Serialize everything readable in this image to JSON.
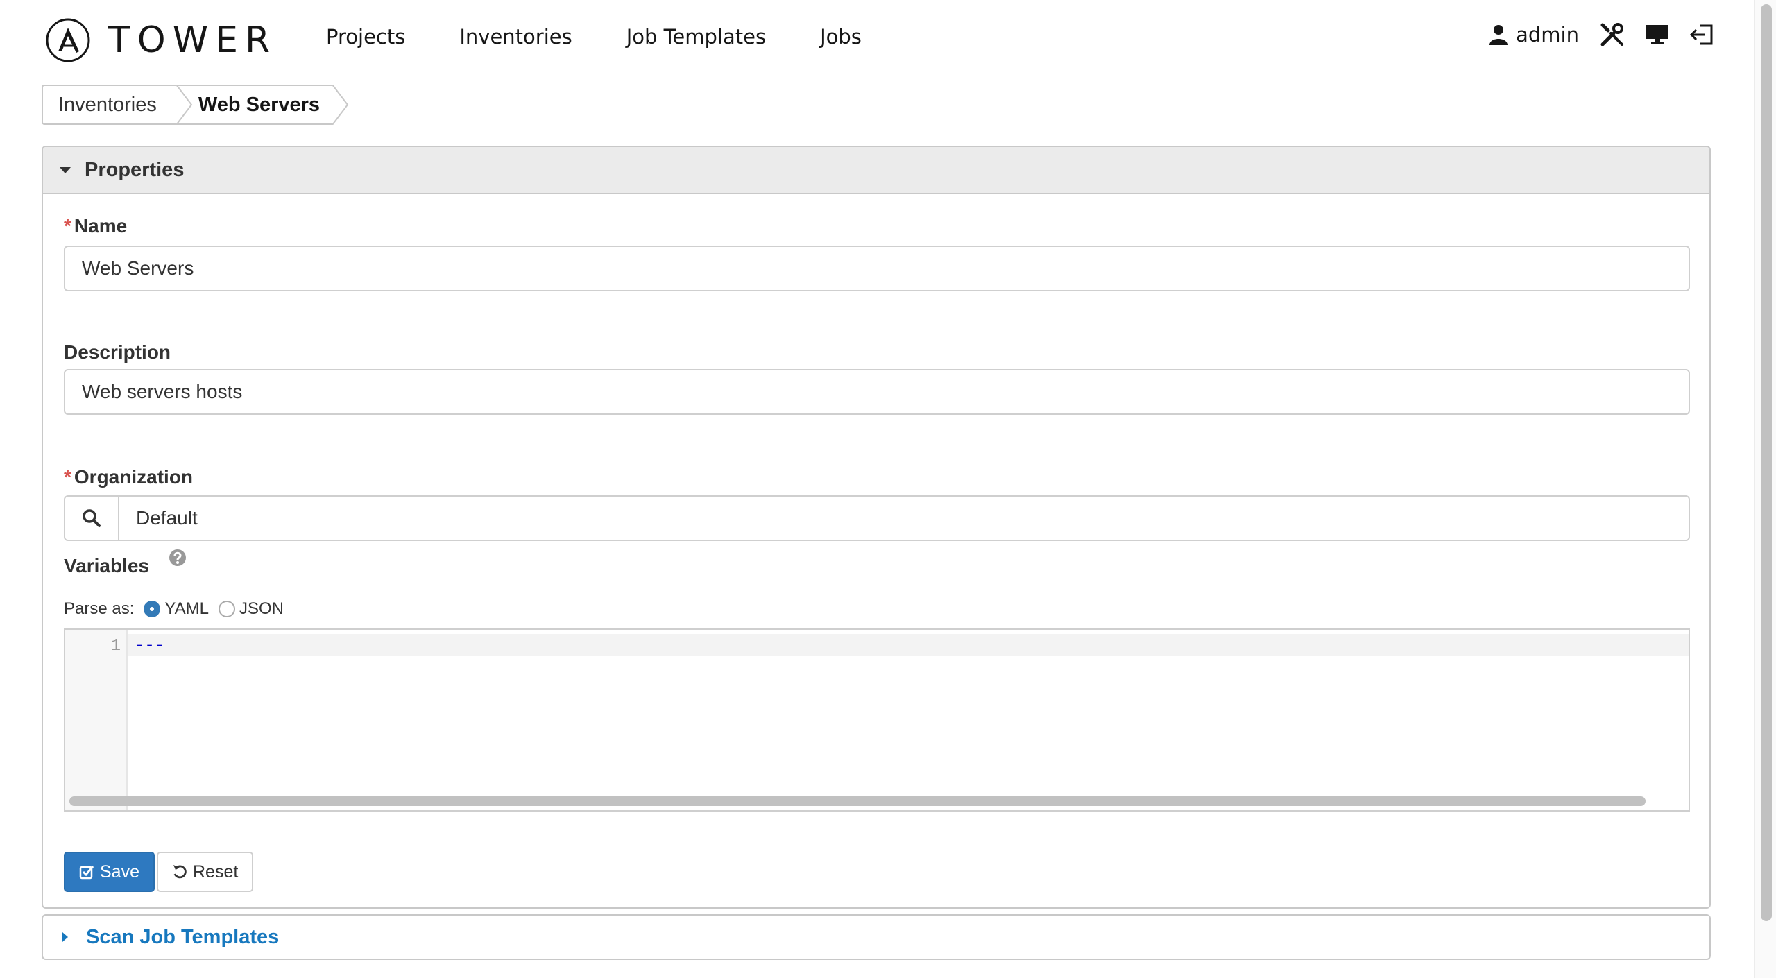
{
  "app": {
    "brand": "TOWER"
  },
  "nav": {
    "links": [
      "Projects",
      "Inventories",
      "Job Templates",
      "Jobs"
    ],
    "user": "admin"
  },
  "breadcrumb": {
    "items": [
      "Inventories",
      "Web Servers"
    ]
  },
  "properties_panel": {
    "title": "Properties",
    "name": {
      "label": "Name",
      "required_mark": "*",
      "value": "Web Servers"
    },
    "description": {
      "label": "Description",
      "value": "Web servers hosts"
    },
    "organization": {
      "label": "Organization",
      "required_mark": "*",
      "value": "Default"
    },
    "variables": {
      "label": "Variables",
      "parse_label": "Parse as:",
      "options": [
        "YAML",
        "JSON"
      ],
      "selected": "YAML",
      "line_number": "1",
      "code": "---"
    },
    "buttons": {
      "save": "Save",
      "reset": "Reset"
    }
  },
  "scan_panel": {
    "title": "Scan Job Templates"
  },
  "colors": {
    "primary": "#2e79c0",
    "link": "#1778be",
    "required": "#d9534f",
    "header_bg": "#ebebeb"
  },
  "icons": [
    "ansible-logo-icon",
    "user-icon",
    "tools-icon",
    "monitor-icon",
    "logout-icon",
    "search-icon",
    "help-icon",
    "check-square-icon",
    "undo-icon",
    "caret-down-icon",
    "caret-right-icon"
  ]
}
